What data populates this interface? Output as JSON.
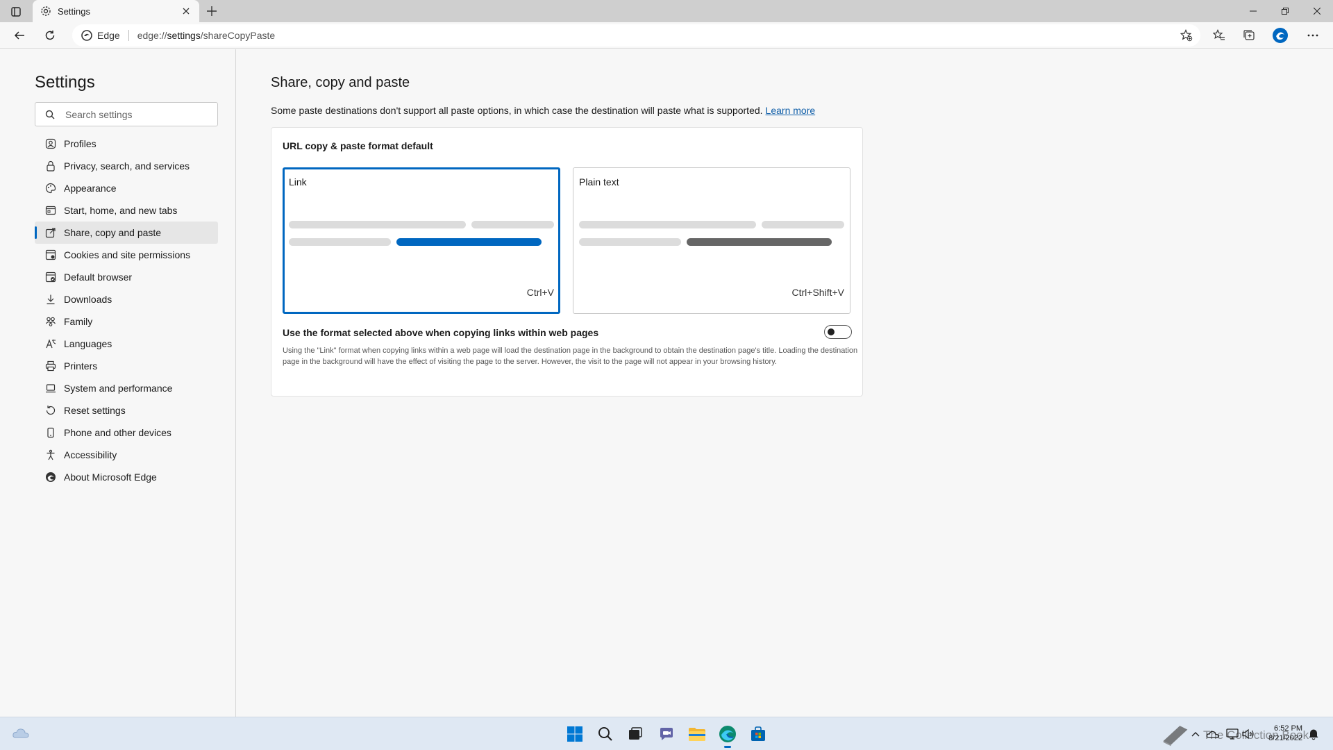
{
  "browser": {
    "tab_title": "Settings",
    "site_name": "Edge",
    "url_scheme": "edge://",
    "url_host": "settings",
    "url_path": "/shareCopyPaste"
  },
  "sidebar": {
    "title": "Settings",
    "search_placeholder": "Search settings",
    "items": [
      {
        "label": "Profiles",
        "icon": "profile-icon"
      },
      {
        "label": "Privacy, search, and services",
        "icon": "lock-icon"
      },
      {
        "label": "Appearance",
        "icon": "palette-icon"
      },
      {
        "label": "Start, home, and new tabs",
        "icon": "home-tabs-icon"
      },
      {
        "label": "Share, copy and paste",
        "icon": "share-icon",
        "active": true
      },
      {
        "label": "Cookies and site permissions",
        "icon": "cookies-icon"
      },
      {
        "label": "Default browser",
        "icon": "default-browser-icon"
      },
      {
        "label": "Downloads",
        "icon": "download-icon"
      },
      {
        "label": "Family",
        "icon": "family-icon"
      },
      {
        "label": "Languages",
        "icon": "languages-icon"
      },
      {
        "label": "Printers",
        "icon": "printer-icon"
      },
      {
        "label": "System and performance",
        "icon": "laptop-icon"
      },
      {
        "label": "Reset settings",
        "icon": "reset-icon"
      },
      {
        "label": "Phone and other devices",
        "icon": "phone-icon"
      },
      {
        "label": "Accessibility",
        "icon": "accessibility-icon"
      },
      {
        "label": "About Microsoft Edge",
        "icon": "edge-logo-icon"
      }
    ]
  },
  "main": {
    "title": "Share, copy and paste",
    "description": "Some paste destinations don't support all paste options, in which case the destination will paste what is supported.",
    "learn_more": "Learn more",
    "card_title": "URL copy & paste format default",
    "options": [
      {
        "label": "Link",
        "shortcut": "Ctrl+V",
        "selected": true
      },
      {
        "label": "Plain text",
        "shortcut": "Ctrl+Shift+V",
        "selected": false
      }
    ],
    "toggle_label": "Use the format selected above when copying links within web pages",
    "toggle_on": false,
    "help_text": "Using the \"Link\" format when copying links within a web page will load the destination page in the background to obtain the destination page's title. Loading the destination page in the background will have the effect of visiting the page to the server. However, the visit to the page will not appear in your browsing history."
  },
  "taskbar": {
    "time": "6:52 PM",
    "date": "8/21/2022",
    "watermark": "The Collection Book"
  },
  "colors": {
    "accent": "#0067c0",
    "plain_text_bar": "#666666",
    "placeholder_bar": "#dcdcdc"
  }
}
